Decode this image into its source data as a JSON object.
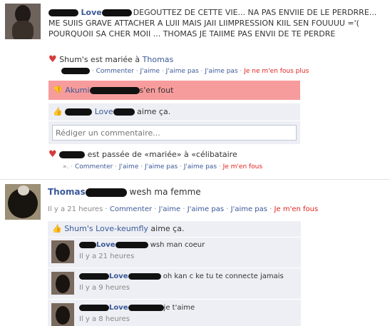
{
  "post1": {
    "author_fragment": "Love",
    "status_text": "DEGOUTTEZ DE CETTE VIE... NA PAS ENVIIE DE LE PERDRRE... ME SUIIS GRAVE ATTACHER A LUII MAIS JAII LIIMPRESSION KIIL SEN FOUUUU ='( POURQUOII SA CHER MOII ... THOMAS JE TAIIME PAS ENVII DE TE PERDRE",
    "relationship": {
      "text": "Shum's est mariée à",
      "link": "Thomas"
    },
    "actions1": [
      "Commenter",
      "J'aime",
      "J'aime pas",
      "J'aime pas"
    ],
    "actions1_red": "Je ne m'en fous plus",
    "dislike_bar": {
      "name": "Akumi",
      "text": "s'en fout"
    },
    "like_bar": {
      "name": "Love",
      "text": "aime ça."
    },
    "comment_placeholder": "Rédiger un commentaire...",
    "relationship2": {
      "text": "est passée de «mariée» à «célibataire"
    },
    "actions2": [
      "Commenter",
      "J'aime",
      "J'aime pas",
      "J'aime pas"
    ],
    "actions2_red": "Je m'en fous",
    "actions2_prefix": "»."
  },
  "post2": {
    "author": "Thomas",
    "text": "wesh ma femme",
    "time": "Il y a 21 heures",
    "actions": [
      "Commenter",
      "J'aime",
      "J'aime pas",
      "J'aime pas"
    ],
    "action_red": "Je m'en fous",
    "like_bar": {
      "name": "Shum's Love-keumfly",
      "text": "aime ça."
    },
    "comments": [
      {
        "name": "Love",
        "text": "wsh man coeur",
        "time": "Il y a 21 heures"
      },
      {
        "name": "Love",
        "text": "oh kan c ke tu te connecte jamais",
        "time": "Il y a 9 heures"
      },
      {
        "name": "Love",
        "text": "je t'aime",
        "time": "Il y a 8 heures"
      }
    ]
  },
  "colors": {
    "link": "#3b5998",
    "red": "#e0241f",
    "pink": "#f79c9c"
  }
}
